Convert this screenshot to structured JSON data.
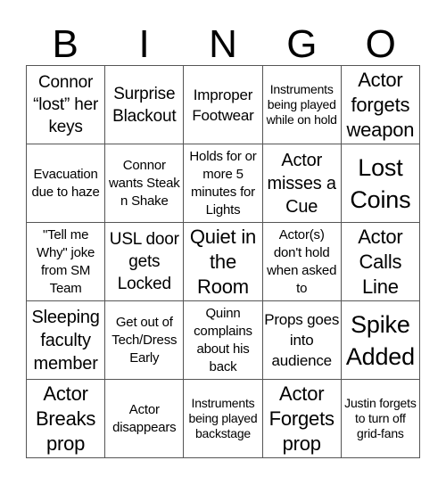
{
  "header": {
    "letters": [
      "B",
      "I",
      "N",
      "G",
      "O"
    ]
  },
  "cells": [
    [
      "Connor “lost” her keys",
      "Surprise Blackout",
      "Improper Footwear",
      "Instruments being played while on hold",
      "Actor forgets weapon"
    ],
    [
      "Evacuation due to haze",
      "Connor wants Steak n Shake",
      "Holds for or more 5 minutes for Lights",
      "Actor misses a Cue",
      "Lost Coins"
    ],
    [
      "\"Tell me Why\" joke from SM Team",
      "USL door gets Locked",
      "Quiet in the Room",
      "Actor(s) don't hold when asked to",
      "Actor Calls Line"
    ],
    [
      "Sleeping faculty member",
      "Get out of Tech/Dress Early",
      "Quinn complains about his back",
      "Props goes into audience",
      "Spike Added"
    ],
    [
      "Actor Breaks prop",
      "Actor disappears",
      "Instruments being played backstage",
      "Actor Forgets prop",
      "Justin forgets to turn off grid-fans"
    ]
  ]
}
